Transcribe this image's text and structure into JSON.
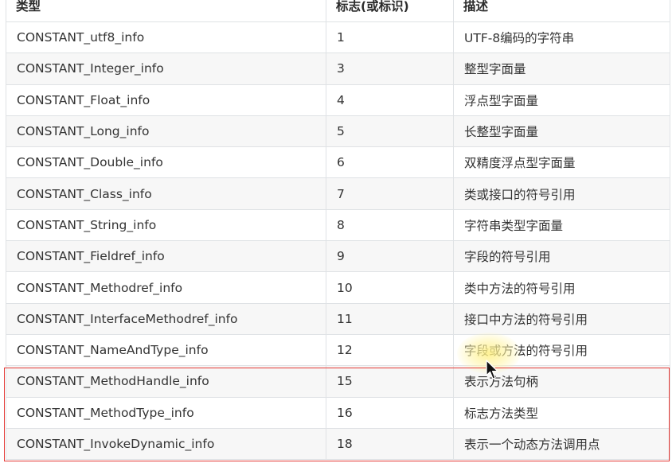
{
  "table": {
    "headers": [
      "类型",
      "标志(或标识)",
      "描述"
    ],
    "rows": [
      {
        "type": "CONSTANT_utf8_info",
        "tag": "1",
        "desc": "UTF-8编码的字符串"
      },
      {
        "type": "CONSTANT_Integer_info",
        "tag": "3",
        "desc": "整型字面量"
      },
      {
        "type": "CONSTANT_Float_info",
        "tag": "4",
        "desc": "浮点型字面量"
      },
      {
        "type": "CONSTANT_Long_info",
        "tag": "5",
        "desc": "长整型字面量"
      },
      {
        "type": "CONSTANT_Double_info",
        "tag": "6",
        "desc": "双精度浮点型字面量"
      },
      {
        "type": "CONSTANT_Class_info",
        "tag": "7",
        "desc": "类或接口的符号引用"
      },
      {
        "type": "CONSTANT_String_info",
        "tag": "8",
        "desc": "字符串类型字面量"
      },
      {
        "type": "CONSTANT_Fieldref_info",
        "tag": "9",
        "desc": "字段的符号引用"
      },
      {
        "type": "CONSTANT_Methodref_info",
        "tag": "10",
        "desc": "类中方法的符号引用"
      },
      {
        "type": "CONSTANT_InterfaceMethodref_info",
        "tag": "11",
        "desc": "接口中方法的符号引用"
      },
      {
        "type": "CONSTANT_NameAndType_info",
        "tag": "12",
        "desc": "字段或方法的符号引用"
      },
      {
        "type": "CONSTANT_MethodHandle_info",
        "tag": "15",
        "desc": "表示方法句柄"
      },
      {
        "type": "CONSTANT_MethodType_info",
        "tag": "16",
        "desc": "标志方法类型"
      },
      {
        "type": "CONSTANT_InvokeDynamic_info",
        "tag": "18",
        "desc": "表示一个动态方法调用点"
      }
    ]
  },
  "colors": {
    "highlight_border": "#e53935",
    "row_stripe": "#f7f7f7",
    "grid_line": "#dfe2e5"
  },
  "icons": {
    "cursor": "mouse-pointer-icon"
  }
}
